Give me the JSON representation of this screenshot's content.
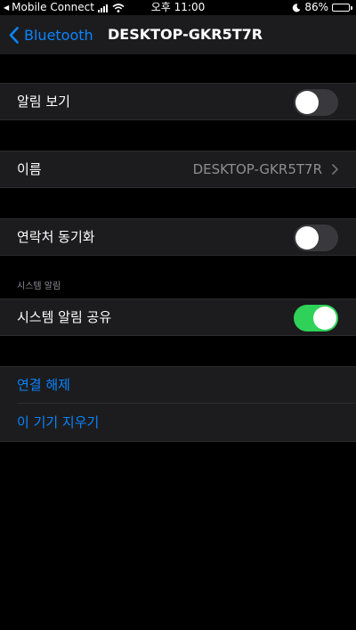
{
  "status_bar": {
    "carrier": "Mobile Connect",
    "time": "오후 11:00",
    "battery_percent": "86%",
    "battery_level": 0.86,
    "icons": [
      "back-triangle-icon",
      "cellular-signal-icon",
      "wifi-icon",
      "moon-icon",
      "battery-icon"
    ]
  },
  "nav": {
    "back_label": "Bluetooth",
    "title": "DESKTOP-GKR5T7R"
  },
  "rows": {
    "show_notifications": {
      "label": "알림 보기",
      "on": false
    },
    "name": {
      "label": "이름",
      "value": "DESKTOP-GKR5T7R"
    },
    "sync_contacts": {
      "label": "연락처 동기화",
      "on": false
    },
    "system_notifications_header": "시스템 알림",
    "share_system_notifications": {
      "label": "시스템 알림 공유",
      "on": true
    },
    "disconnect": {
      "label": "연결 해제"
    },
    "forget_device": {
      "label": "이 기기 지우기"
    }
  },
  "colors": {
    "accent": "#0a84ff",
    "toggle_on": "#30d158",
    "toggle_off": "#39393d",
    "row_bg": "#1c1c1e",
    "secondary_text": "#8e8e93"
  }
}
